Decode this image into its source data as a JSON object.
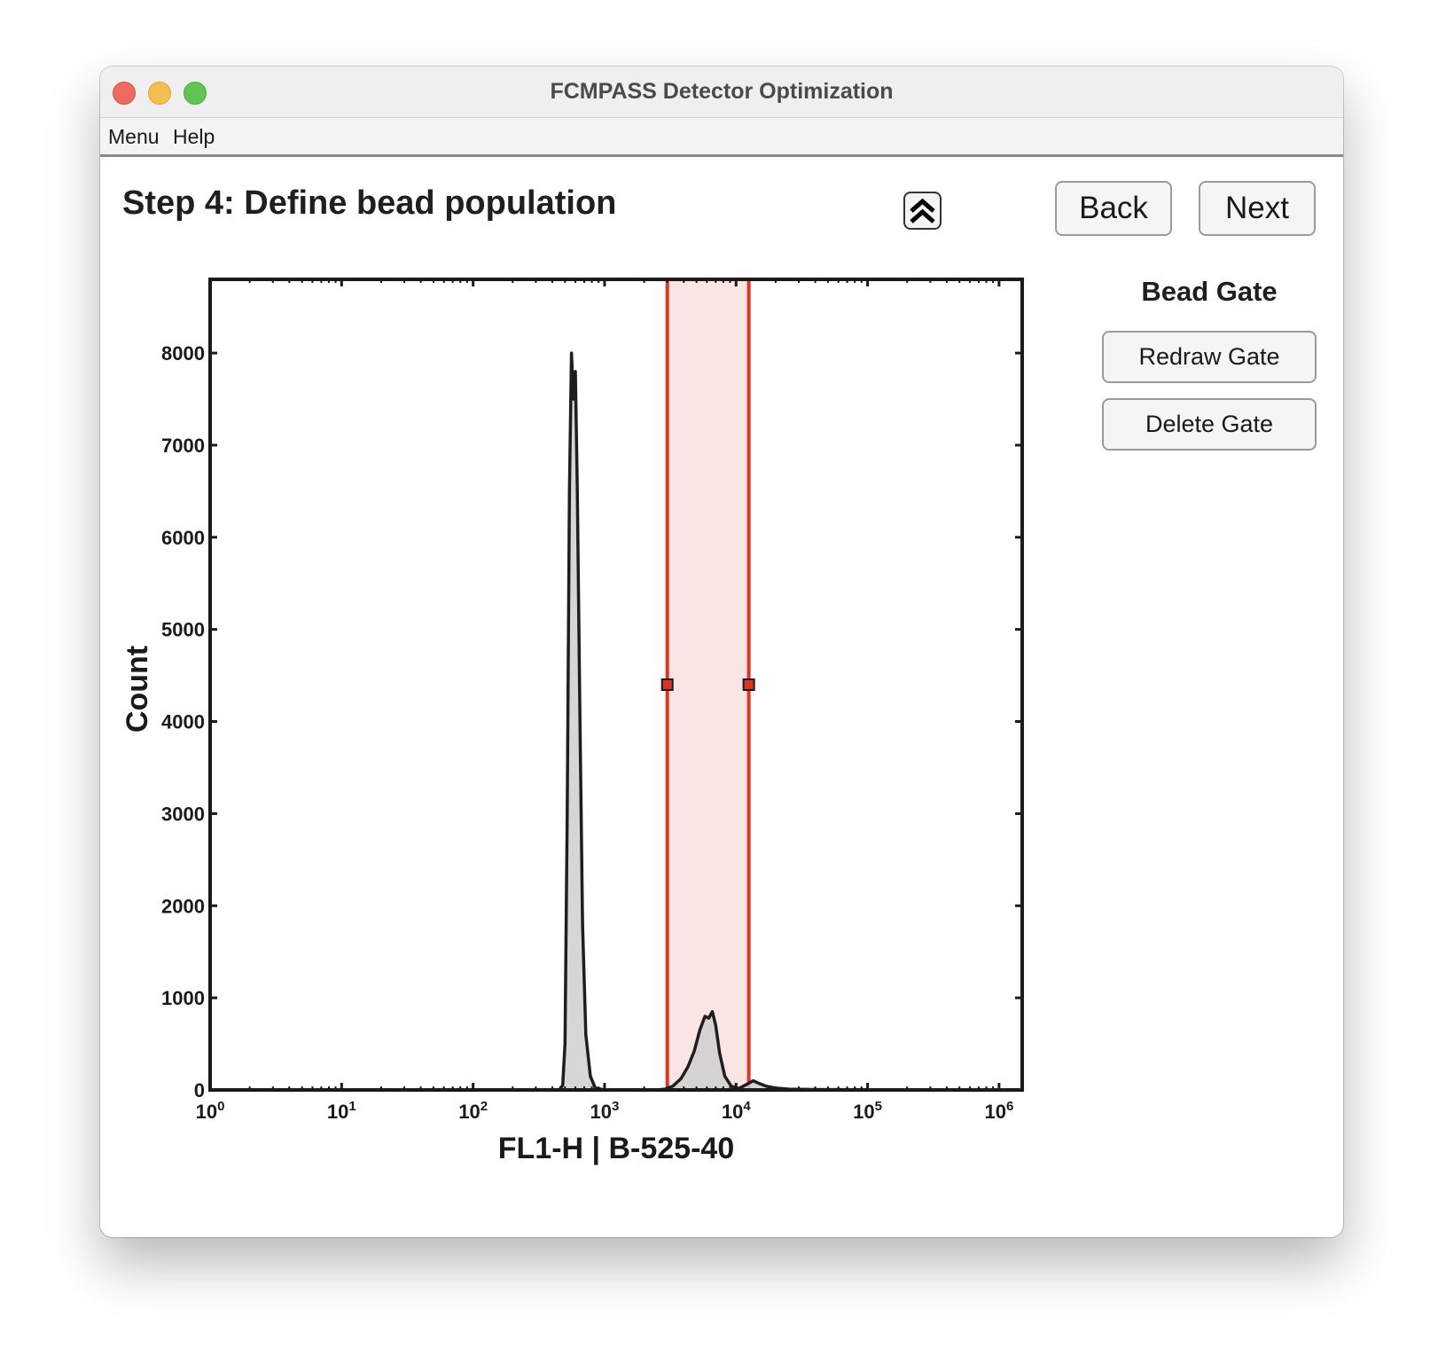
{
  "window": {
    "title": "FCMPASS Detector Optimization"
  },
  "menu": {
    "items": [
      "Menu",
      "Help"
    ]
  },
  "step_title": "Step 4: Define bead population",
  "buttons": {
    "collapse_icon": "chevron-double-up-icon",
    "back": "Back",
    "next": "Next"
  },
  "gate_panel": {
    "heading": "Bead Gate",
    "redraw": "Redraw Gate",
    "delete": "Delete Gate"
  },
  "colors": {
    "gate_line": "#e03326",
    "gate_fill": "#fbe4e4",
    "histogram_fill": "#cfcfcf",
    "histogram_line": "#1e1e1e"
  },
  "chart_data": {
    "type": "area",
    "xlabel": "FL1-H | B-525-40",
    "ylabel": "Count",
    "x_scale": "log",
    "xlim": [
      1,
      1500000
    ],
    "ylim": [
      0,
      8800
    ],
    "x_ticks": [
      {
        "value": 1,
        "base": "10",
        "exp": "0"
      },
      {
        "value": 10,
        "base": "10",
        "exp": "1"
      },
      {
        "value": 100,
        "base": "10",
        "exp": "2"
      },
      {
        "value": 1000,
        "base": "10",
        "exp": "3"
      },
      {
        "value": 10000,
        "base": "10",
        "exp": "4"
      },
      {
        "value": 100000,
        "base": "10",
        "exp": "5"
      },
      {
        "value": 1000000,
        "base": "10",
        "exp": "6"
      }
    ],
    "y_ticks": [
      0,
      1000,
      2000,
      3000,
      4000,
      5000,
      6000,
      7000,
      8000
    ],
    "series": [
      {
        "x": [
          1,
          100,
          450,
          480,
          500,
          520,
          540,
          560,
          580,
          600,
          620,
          650,
          680,
          720,
          780,
          850,
          1000,
          1500,
          2500,
          2900,
          3300,
          3800,
          4300,
          4800,
          5300,
          5800,
          6200,
          6600,
          7000,
          7500,
          8200,
          9200,
          10500,
          12000,
          13500,
          15000,
          17000,
          20000,
          25000,
          40000,
          100000,
          1000000,
          1500000
        ],
        "y": [
          0,
          0,
          0,
          50,
          500,
          3000,
          6500,
          8000,
          7500,
          7800,
          6500,
          4000,
          1800,
          600,
          150,
          20,
          0,
          0,
          0,
          10,
          40,
          120,
          250,
          420,
          650,
          800,
          780,
          850,
          700,
          400,
          150,
          40,
          15,
          60,
          100,
          70,
          40,
          20,
          10,
          5,
          2,
          0,
          0
        ]
      }
    ],
    "gate": {
      "x_min": 3000,
      "x_max": 12500,
      "handle_y": 4400
    }
  }
}
